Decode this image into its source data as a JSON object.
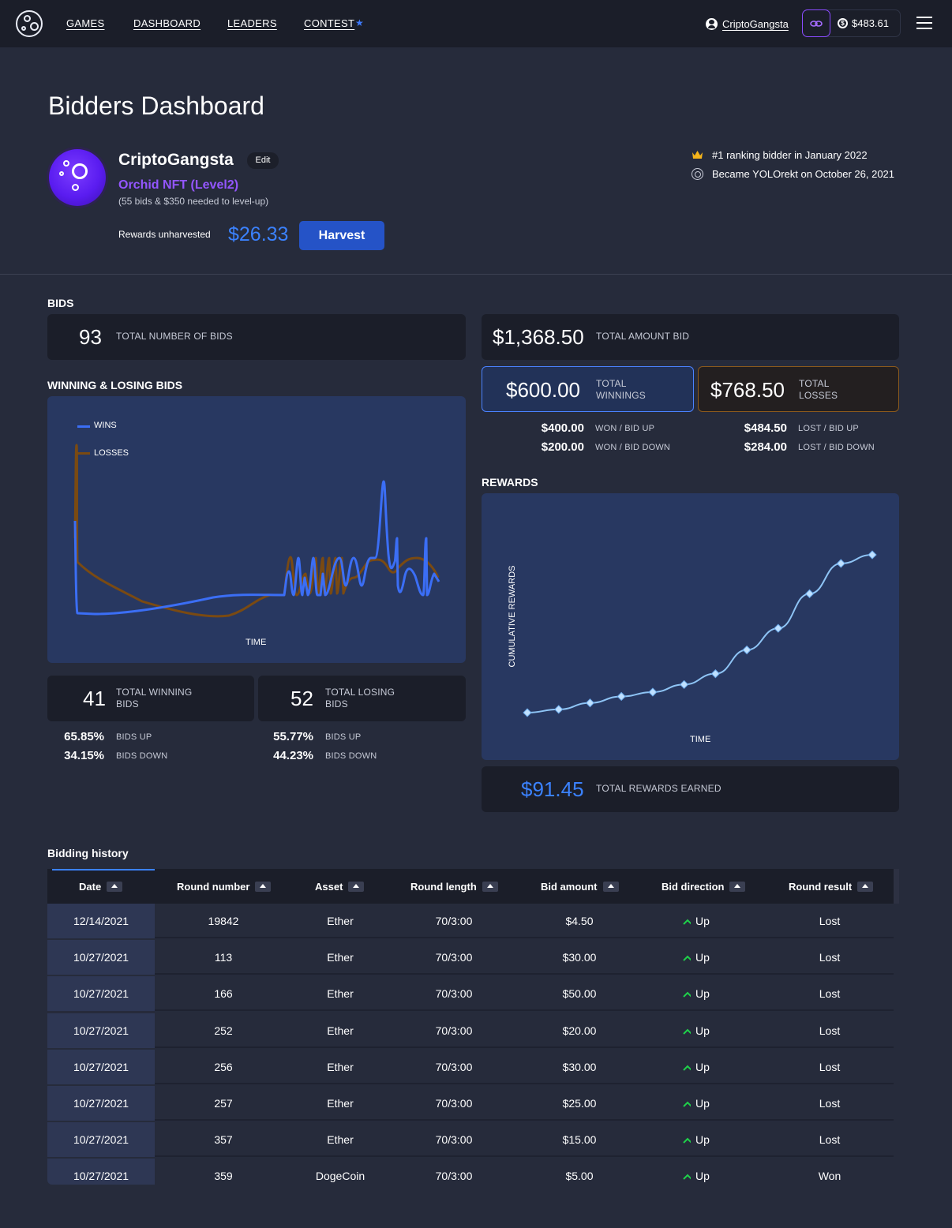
{
  "nav": {
    "links": [
      "GAMES",
      "DASHBOARD",
      "LEADERS",
      "CONTEST"
    ],
    "username": "CriptoGangsta",
    "balance": "$483.61"
  },
  "header": {
    "title": "Bidders Dashboard",
    "username": "CriptoGangsta",
    "edit_label": "Edit",
    "level": "Orchid NFT (Level2)",
    "level_note": "(55 bids & $350 needed to level-up)",
    "rewards_label": "Rewards unharvested",
    "rewards_value": "$26.33",
    "harvest_label": "Harvest",
    "rank_text": "#1 ranking bidder in January 2022",
    "since_text": "Became YOLOrekt on October 26, 2021"
  },
  "bids": {
    "title": "BIDS",
    "total_bids": "93",
    "total_bids_label": "TOTAL NUMBER OF BIDS",
    "total_amount": "$1,368.50",
    "total_amount_label": "TOTAL AMOUNT BID",
    "total_winnings": "$600.00",
    "total_winnings_label": "TOTAL WINNINGS",
    "total_losses": "$768.50",
    "total_losses_label": "TOTAL LOSSES",
    "won_up": "$400.00",
    "won_up_label": "WON / BID UP",
    "won_down": "$200.00",
    "won_down_label": "WON / BID DOWN",
    "lost_up": "$484.50",
    "lost_up_label": "LOST / BID UP",
    "lost_down": "$284.00",
    "lost_down_label": "LOST / BID DOWN"
  },
  "winlose": {
    "title": "WINNING & LOSING BIDS",
    "legend_wins": "WINS",
    "legend_losses": "LOSSES",
    "xlabel": "TIME",
    "wins_color": "#3b6ef5",
    "losses_color": "#7a4a12",
    "winning_bids": "41",
    "winning_label": "TOTAL WINNING BIDS",
    "losing_bids": "52",
    "losing_label": "TOTAL LOSING BIDS",
    "win_up_pct": "65.85%",
    "win_down_pct": "34.15%",
    "lose_up_pct": "55.77%",
    "lose_down_pct": "44.23%",
    "bids_up_label": "BIDS UP",
    "bids_down_label": "BIDS DOWN"
  },
  "rewards": {
    "title": "REWARDS",
    "ylabel": "CUMULATIVE REWARDS",
    "xlabel": "TIME",
    "total": "$91.45",
    "total_label": "TOTAL REWARDS EARNED"
  },
  "chart_data": [
    {
      "type": "line",
      "series": [
        {
          "name": "WINS"
        },
        {
          "name": "LOSSES"
        }
      ],
      "xlabel": "TIME",
      "ylabel": "",
      "legend": "top-left"
    },
    {
      "type": "line",
      "xlabel": "TIME",
      "ylabel": "CUMULATIVE REWARDS",
      "values": [
        0,
        1.5,
        4.5,
        7.5,
        9.5,
        13,
        18,
        29,
        39,
        55,
        69,
        73
      ]
    }
  ],
  "history": {
    "title": "Bidding history",
    "columns": [
      "Date",
      "Round number",
      "Asset",
      "Round length",
      "Bid amount",
      "Bid direction",
      "Round result"
    ],
    "rows": [
      [
        "12/14/2021",
        "19842",
        "Ether",
        "70/3:00",
        "$4.50",
        "Up",
        "Lost"
      ],
      [
        "10/27/2021",
        "113",
        "Ether",
        "70/3:00",
        "$30.00",
        "Up",
        "Lost"
      ],
      [
        "10/27/2021",
        "166",
        "Ether",
        "70/3:00",
        "$50.00",
        "Up",
        "Lost"
      ],
      [
        "10/27/2021",
        "252",
        "Ether",
        "70/3:00",
        "$20.00",
        "Up",
        "Lost"
      ],
      [
        "10/27/2021",
        "256",
        "Ether",
        "70/3:00",
        "$30.00",
        "Up",
        "Lost"
      ],
      [
        "10/27/2021",
        "257",
        "Ether",
        "70/3:00",
        "$25.00",
        "Up",
        "Lost"
      ],
      [
        "10/27/2021",
        "357",
        "Ether",
        "70/3:00",
        "$15.00",
        "Up",
        "Lost"
      ],
      [
        "10/27/2021",
        "359",
        "DogeCoin",
        "70/3:00",
        "$5.00",
        "Up",
        "Won"
      ]
    ]
  }
}
